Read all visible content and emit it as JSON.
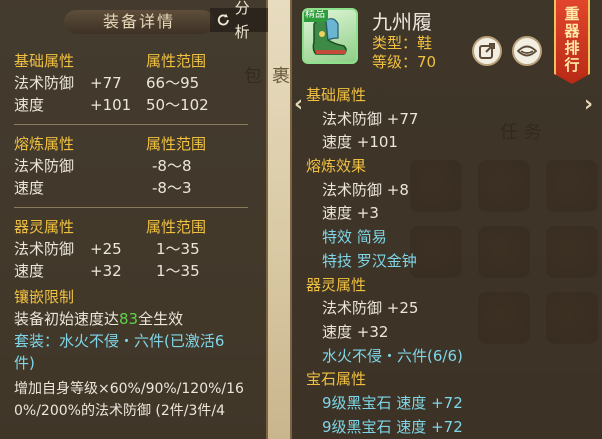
{
  "left": {
    "title": "装备详情",
    "analyze_label": "分析",
    "base_section": {
      "label": "基础属性",
      "range_header": "属性范围",
      "rows": [
        {
          "name": "法术防御",
          "value": "+77",
          "range": "66～95"
        },
        {
          "name": "速度",
          "value": "+101",
          "range": "50～102"
        }
      ]
    },
    "smelt_section": {
      "label": "熔炼属性",
      "range_header": "属性范围",
      "rows": [
        {
          "name": "法术防御",
          "range": "-8～8"
        },
        {
          "name": "速度",
          "range": "-8～3"
        }
      ]
    },
    "spirit_section": {
      "label": "器灵属性",
      "range_header": "属性范围",
      "rows": [
        {
          "name": "法术防御",
          "value": "+25",
          "range": "1～35"
        },
        {
          "name": "速度",
          "value": "+32",
          "range": "1～35"
        }
      ]
    },
    "inlay": {
      "label": "镶嵌限制",
      "text_prefix": "装备初始速度达",
      "text_number": "83",
      "text_suffix": "全生效"
    },
    "set_line1": "套装：水火不侵・六件(已激活6",
    "set_line2": "件)",
    "bonus_line1": "增加自身等级×60%/90%/120%/16",
    "bonus_line2": "0%/200%的法术防御 (2件/3件/4"
  },
  "right": {
    "item_tag": "精品",
    "name": "九州履",
    "type": "类型：鞋",
    "level": "等级：70",
    "ribbon": "重器排行",
    "base_label": "基础属性",
    "base_rows": [
      "法术防御 +77",
      "速度 +101"
    ],
    "smelt_label": "熔炼效果",
    "smelt_rows": [
      "法术防御 +8",
      "速度 +3"
    ],
    "special_effect": "特效  简易",
    "special_skill": "特技  罗汉金钟",
    "spirit_label": "器灵属性",
    "spirit_rows": [
      "法术防御 +25",
      "速度 +32"
    ],
    "set_text": "水火不侵・六件(6/6)",
    "gem_label": "宝石属性",
    "gem_rows": [
      "9级黑宝石  速度 +72",
      "9级黑宝石  速度 +72"
    ]
  },
  "background": {
    "tab_bag": "包",
    "tab_2": "裹",
    "tab_task": "任 务"
  },
  "colors": {
    "gold": "#f0c040",
    "cyan": "#7fd6e8",
    "green": "#5fd24a",
    "panel_bg": "#2c241a"
  }
}
